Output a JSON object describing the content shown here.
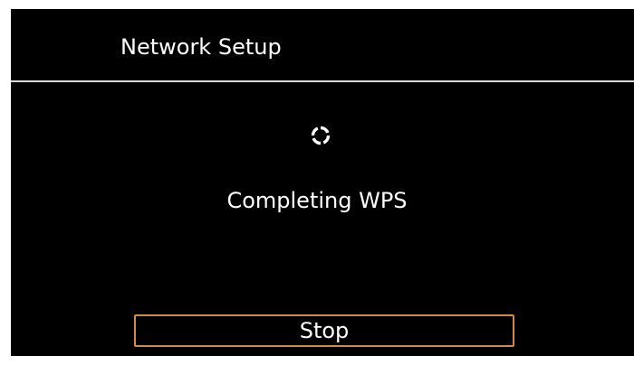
{
  "header": {
    "title": "Network Setup"
  },
  "main": {
    "status_text": "Completing WPS",
    "spinner_icon": "loading-spinner-icon"
  },
  "actions": {
    "stop_label": "Stop"
  },
  "colors": {
    "background": "#000000",
    "text": "#ffffff",
    "divider": "#d8d8d8",
    "button_border": "#d4894a"
  }
}
